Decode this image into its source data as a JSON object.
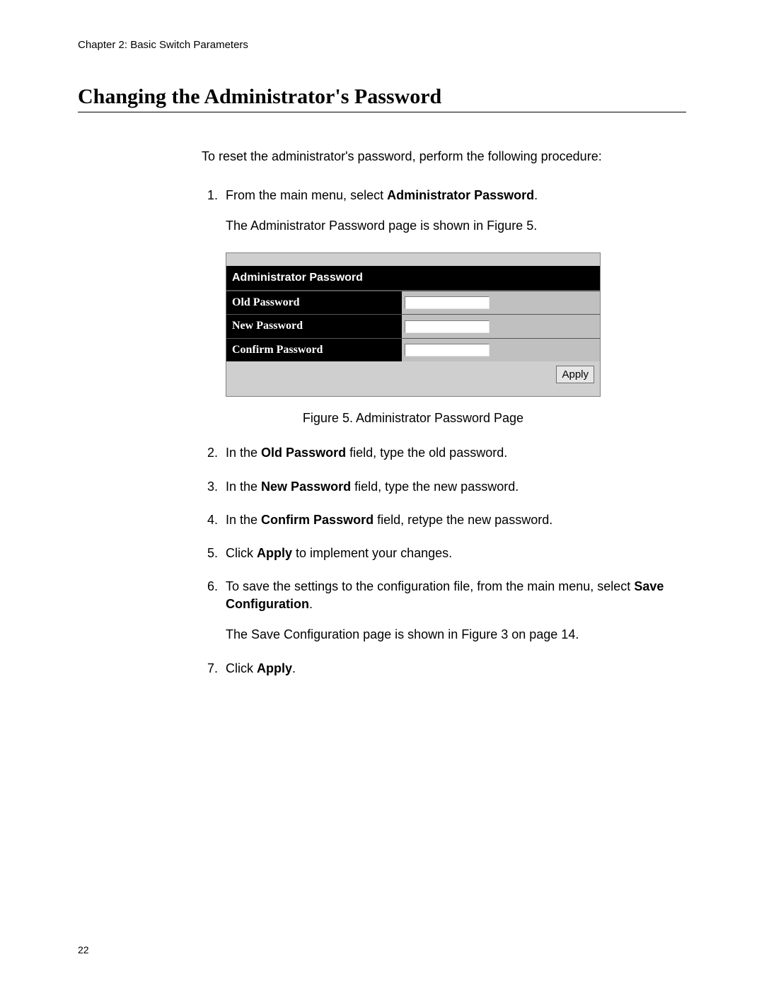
{
  "chapter_header": "Chapter 2: Basic Switch Parameters",
  "section_title": "Changing the Administrator's Password",
  "intro": "To reset the administrator's password, perform the following procedure:",
  "steps": {
    "s1a": "From the main menu, select ",
    "s1b": "Administrator Password",
    "s1c": ".",
    "s1_sub": "The Administrator Password page is shown in Figure 5.",
    "s2a": "In the ",
    "s2b": "Old Password",
    "s2c": " field, type the old password.",
    "s3a": "In the ",
    "s3b": "New Password",
    "s3c": " field, type the new password.",
    "s4a": "In the ",
    "s4b": "Confirm Password",
    "s4c": " field, retype the new password.",
    "s5a": "Click ",
    "s5b": "Apply",
    "s5c": " to implement your changes.",
    "s6a": "To save the settings to the configuration file, from the main menu, select ",
    "s6b": "Save Configuration",
    "s6c": ".",
    "s6_sub": "The Save Configuration page is shown in Figure 3 on page 14.",
    "s7a": "Click ",
    "s7b": "Apply",
    "s7c": "."
  },
  "figure": {
    "panel_title": "Administrator Password",
    "row1_label": "Old Password",
    "row2_label": "New Password",
    "row3_label": "Confirm Password",
    "apply_label": "Apply",
    "caption": "Figure 5. Administrator Password Page"
  },
  "page_number": "22"
}
